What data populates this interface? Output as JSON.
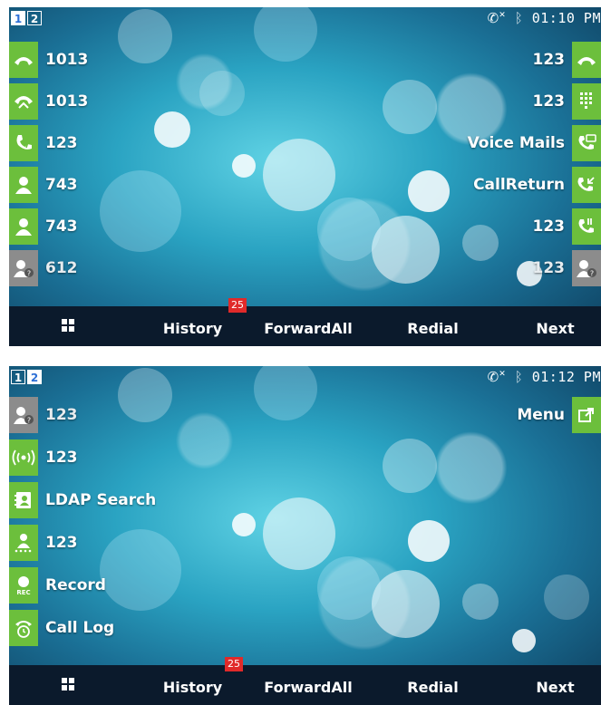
{
  "colors": {
    "accent_green": "#6cbf3c",
    "soft_gray": "#8c8c8c",
    "softbar_bg": "#0b1a2c",
    "badge_red": "#e02a2a"
  },
  "screen1": {
    "accounts": [
      "1",
      "2"
    ],
    "active_account": "1",
    "time": "01:10 PM",
    "left_keys": [
      {
        "label": "1013",
        "icon": "handset-icon",
        "style": "green"
      },
      {
        "label": "1013",
        "icon": "handset-hangup-icon",
        "style": "green"
      },
      {
        "label": "123",
        "icon": "speed-dial-handset-icon",
        "style": "green"
      },
      {
        "label": "743",
        "icon": "contact-person-icon",
        "style": "green"
      },
      {
        "label": "743",
        "icon": "contact-person-icon",
        "style": "green"
      },
      {
        "label": "612",
        "icon": "presence-unknown-icon",
        "style": "gray"
      }
    ],
    "right_keys": [
      {
        "label": "123",
        "icon": "handset-icon",
        "style": "green"
      },
      {
        "label": "123",
        "icon": "dialpad-icon",
        "style": "green"
      },
      {
        "label": "Voice Mails",
        "icon": "voicemail-icon",
        "style": "green"
      },
      {
        "label": "CallReturn",
        "icon": "call-return-icon",
        "style": "green"
      },
      {
        "label": "123",
        "icon": "call-park-icon",
        "style": "green"
      },
      {
        "label": "123",
        "icon": "presence-unknown-icon",
        "style": "gray"
      }
    ],
    "softkeys": [
      "History",
      "ForwardAll",
      "Redial",
      "Next"
    ],
    "badge": "25"
  },
  "screen2": {
    "accounts": [
      "1",
      "2"
    ],
    "active_account": "2",
    "time": "01:12 PM",
    "left_keys": [
      {
        "label": "123",
        "icon": "presence-unknown-icon",
        "style": "gray"
      },
      {
        "label": "123",
        "icon": "intercom-icon",
        "style": "green"
      },
      {
        "label": "LDAP Search",
        "icon": "ldap-contact-card-icon",
        "style": "green"
      },
      {
        "label": "123",
        "icon": "transfer-person-icon",
        "style": "green"
      },
      {
        "label": "Record",
        "icon": "record-icon",
        "style": "green"
      },
      {
        "label": "Call Log",
        "icon": "call-log-icon",
        "style": "green"
      }
    ],
    "right_keys": [
      {
        "label": "Menu",
        "icon": "menu-external-icon",
        "style": "green"
      }
    ],
    "softkeys": [
      "History",
      "ForwardAll",
      "Redial",
      "Next"
    ],
    "badge": "25"
  }
}
